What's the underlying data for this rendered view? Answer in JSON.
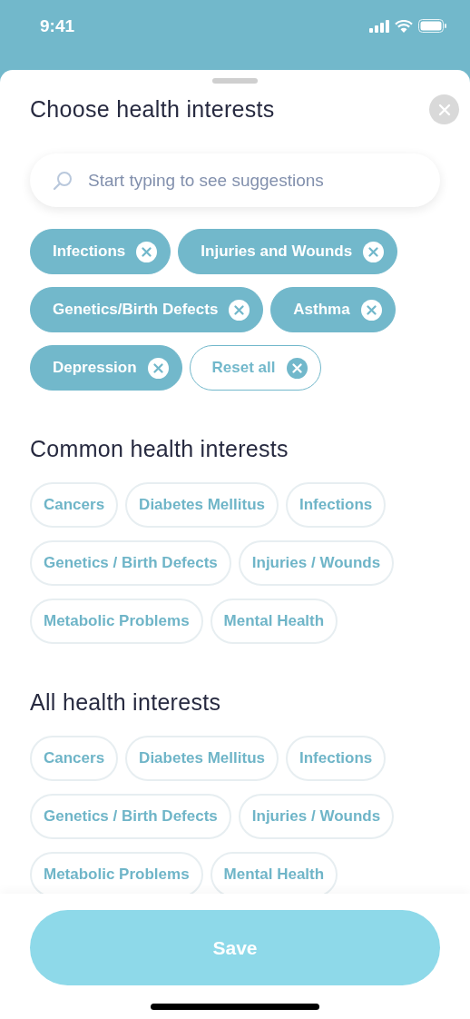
{
  "status_bar": {
    "time": "9:41"
  },
  "sheet": {
    "title": "Choose health interests"
  },
  "search": {
    "placeholder": "Start typing to see suggestions"
  },
  "selected_chips": [
    {
      "label": "Infections",
      "kind": "tag"
    },
    {
      "label": "Injuries and Wounds",
      "kind": "tag"
    },
    {
      "label": "Genetics/Birth Defects",
      "kind": "tag"
    },
    {
      "label": "Asthma",
      "kind": "tag"
    },
    {
      "label": "Depression",
      "kind": "tag"
    },
    {
      "label": "Reset all",
      "kind": "reset"
    }
  ],
  "sections": [
    {
      "title": "Common health interests",
      "chips": [
        "Cancers",
        "Diabetes Mellitus",
        "Infections",
        "Genetics / Birth Defects",
        "Injuries / Wounds",
        "Metabolic Problems",
        "Mental Health"
      ]
    },
    {
      "title": "All health interests",
      "chips": [
        "Cancers",
        "Diabetes Mellitus",
        "Infections",
        "Genetics / Birth Defects",
        "Injuries / Wounds",
        "Metabolic Problems",
        "Mental Health"
      ]
    }
  ],
  "save_button": {
    "label": "Save"
  }
}
